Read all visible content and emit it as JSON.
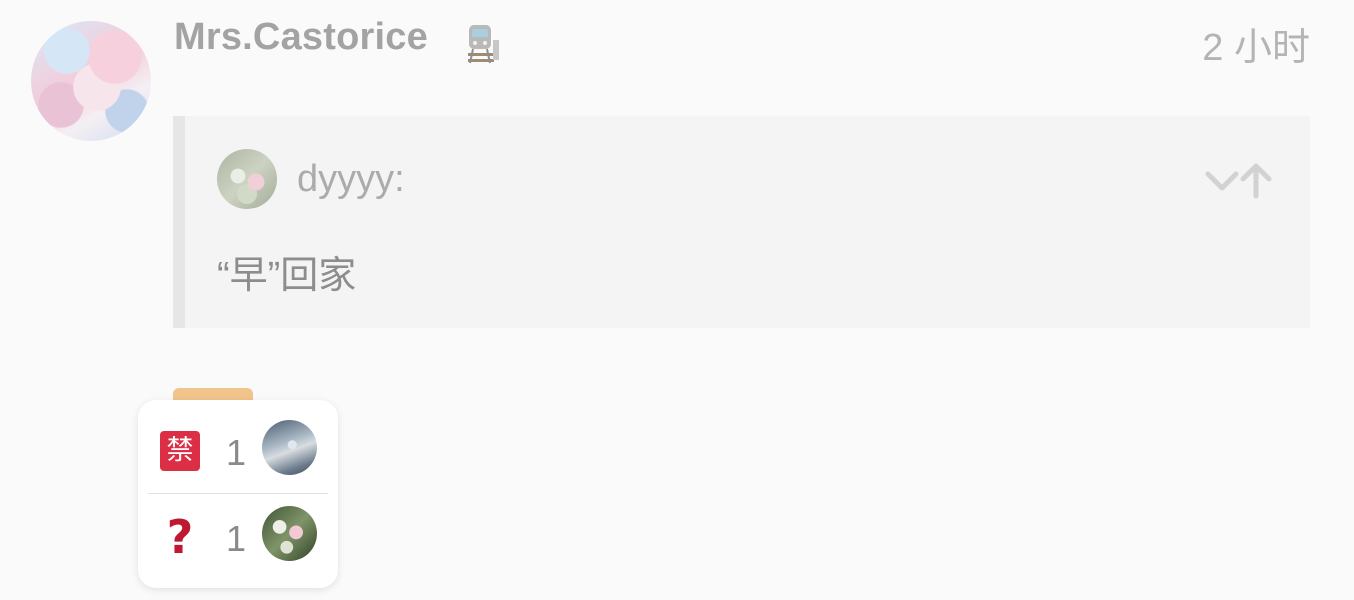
{
  "post": {
    "username": "Mrs.Castorice",
    "user_badge_icon": "train-icon",
    "timestamp": "2 小时"
  },
  "quote": {
    "username": "dyyyy:",
    "text": "“早”回家",
    "controls": [
      "chevron-down-icon",
      "arrow-up-icon"
    ]
  },
  "reactions": [
    {
      "emoji": "禁",
      "emoji_name": "prohibited-emoji",
      "count": "1"
    },
    {
      "emoji": "?",
      "emoji_name": "question-mark-emoji",
      "count": "1"
    }
  ],
  "colors": {
    "background": "#fafafa",
    "quote_background": "#f4f4f4",
    "quote_border": "#e6e6e6",
    "ban_emoji": "#dc2f45",
    "question_emoji": "#be1931",
    "reaction_tab": "#f0c48a"
  }
}
